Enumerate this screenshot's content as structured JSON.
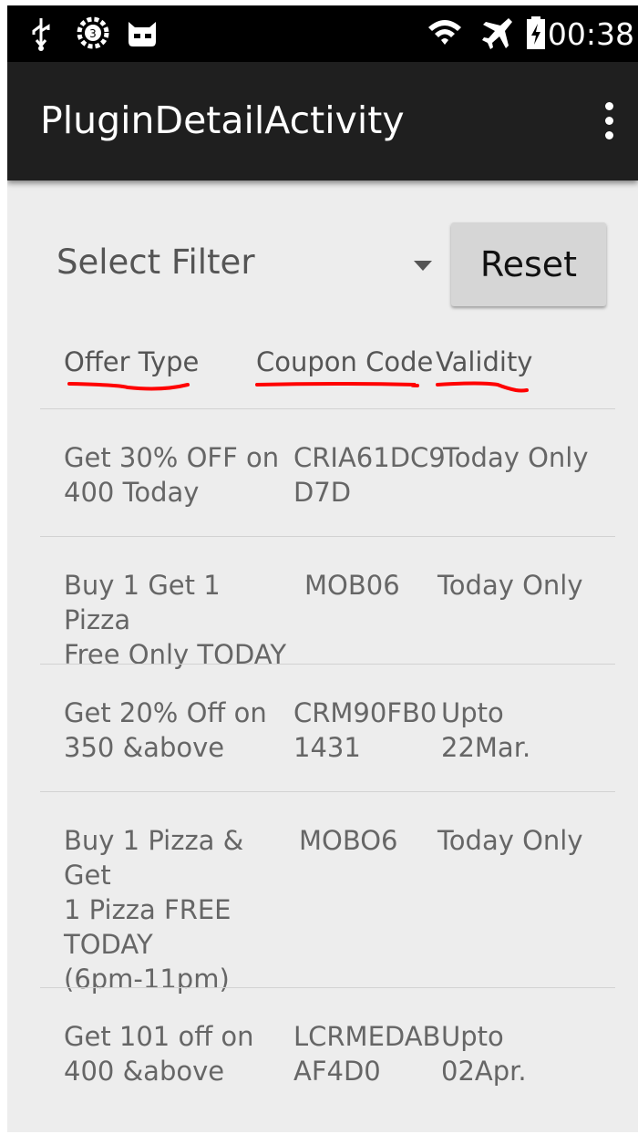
{
  "status_bar": {
    "time": "00:38",
    "icons": [
      "usb-icon",
      "settings-badge-icon",
      "cyanogen-icon",
      "wifi-icon",
      "airplane-icon",
      "battery-charging-icon"
    ]
  },
  "app_bar": {
    "title": "PluginDetailActivity",
    "overflow_icon": "overflow-menu-icon"
  },
  "filter": {
    "spinner_label": "Select Filter",
    "reset_label": "Reset"
  },
  "columns": {
    "offer_type": "Offer Type",
    "coupon_code": "Coupon Code",
    "validity": "Validity"
  },
  "annotation_color": "#ff0000",
  "rows": [
    {
      "offer": "Get 30% OFF on\n400 Today",
      "code": "CRIA61DC9\nD7D",
      "validity": "Today Only"
    },
    {
      "offer": "Buy 1 Get 1 Pizza\nFree Only TODAY",
      "code": "MOB06",
      "validity": "Today Only"
    },
    {
      "offer": " Get 20% Off on\n350 &above",
      "code": "CRM90FB0\n1431",
      "validity": "Upto\n22Mar."
    },
    {
      "offer": " Buy 1 Pizza & Get\n1 Pizza FREE\nTODAY\n(6pm-11pm)",
      "code": "MOBO6",
      "validity": "Today Only"
    },
    {
      "offer": " Get 101 off on\n400 &above",
      "code": "LCRMEDAB\nAF4D0",
      "validity": "Upto\n02Apr."
    }
  ]
}
